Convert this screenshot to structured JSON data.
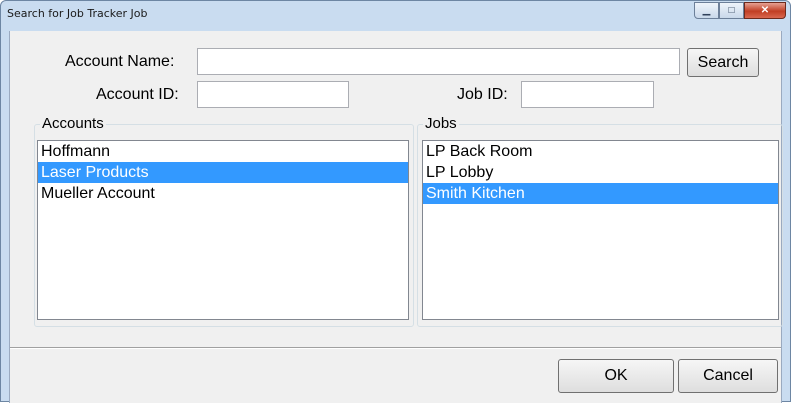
{
  "window": {
    "title": "Search for Job Tracker Job",
    "minimize_glyph": "▁",
    "maximize_glyph": "□",
    "close_glyph": "✕"
  },
  "form": {
    "account_name_label": "Account Name:",
    "account_name_value": "",
    "search_label": "Search",
    "account_id_label": "Account ID:",
    "account_id_value": "",
    "job_id_label": "Job ID:",
    "job_id_value": ""
  },
  "accounts": {
    "label": "Accounts",
    "items": [
      "Hoffmann",
      "Laser Products",
      "Mueller Account"
    ],
    "selected_index": 1
  },
  "jobs": {
    "label": "Jobs",
    "items": [
      "LP Back Room",
      "LP Lobby",
      "Smith Kitchen"
    ],
    "selected_index": 2
  },
  "footer": {
    "ok_label": "OK",
    "cancel_label": "Cancel"
  },
  "colors": {
    "selection": "#3399ff",
    "window_frame": "#c9dcf0",
    "close_button": "#c13e24"
  }
}
